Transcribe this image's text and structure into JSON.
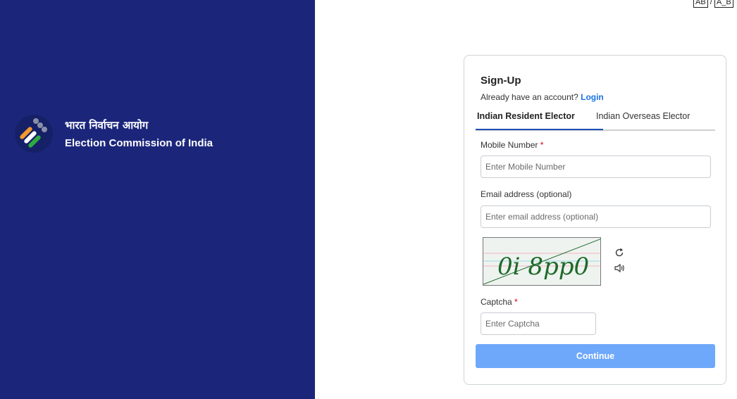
{
  "brand": {
    "hindi_name": "भारत निर्वाचन आयोग",
    "english_name": "Election Commission of India",
    "logo_icon": "eci-ballot-logo-icon"
  },
  "lang_switch": {
    "first": "AB",
    "separator": "/",
    "second": "A_B"
  },
  "signup": {
    "title": "Sign-Up",
    "login_prompt": "Already have an account?",
    "login_link": "Login",
    "tabs": [
      {
        "label": "Indian Resident Elector",
        "active": true
      },
      {
        "label": "Indian Overseas Elector",
        "active": false
      }
    ],
    "mobile": {
      "label": "Mobile Number",
      "required_mark": "*",
      "placeholder": "Enter Mobile Number",
      "value": ""
    },
    "email": {
      "label": "Email address (optional)",
      "placeholder": "Enter email address (optional)",
      "value": ""
    },
    "captcha": {
      "image_text": "0i 8pp0",
      "refresh_icon": "refresh-icon",
      "audio_icon": "speaker-icon",
      "label": "Captcha",
      "required_mark": "*",
      "placeholder": "Enter Captcha",
      "value": ""
    },
    "continue_label": "Continue"
  },
  "colors": {
    "left_panel": "#1b267b",
    "accent": "#1a73e8",
    "button": "#6ea8fb"
  }
}
